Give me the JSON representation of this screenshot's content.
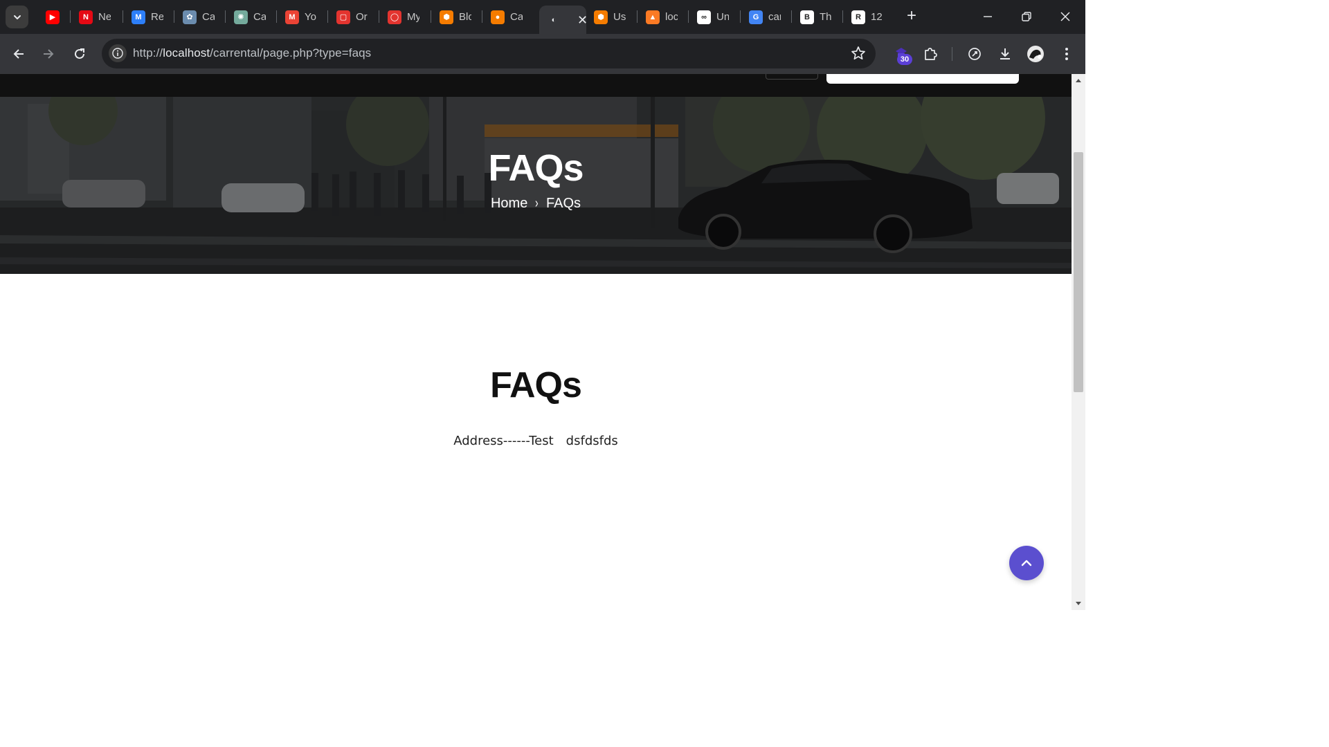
{
  "browser": {
    "tabs": [
      {
        "title": "",
        "icon": "youtube-icon",
        "color": "#ff0000"
      },
      {
        "title": "Ne",
        "icon": "netflix-icon",
        "color": "#e50914"
      },
      {
        "title": "Re",
        "icon": "metaview-icon",
        "color": "#2d7ff9"
      },
      {
        "title": "Ca",
        "icon": "car-site-icon",
        "color": "#6b8cae"
      },
      {
        "title": "Ca",
        "icon": "chatgpt-icon",
        "color": "#74aa9c"
      },
      {
        "title": "Yo",
        "icon": "gmail-icon",
        "color": "#ea4335"
      },
      {
        "title": "Or",
        "icon": "oracle-icon",
        "color": "#e3342f"
      },
      {
        "title": "My",
        "icon": "oracle-ring-icon",
        "color": "#e3342f"
      },
      {
        "title": "Blc",
        "icon": "blogger-icon",
        "color": "#f57c00"
      },
      {
        "title": "Ca",
        "icon": "ubuntu-icon",
        "color": "#f57c00"
      },
      {
        "title": "",
        "icon": "page-favicon-icon",
        "color": "#e8eaed",
        "active": true
      },
      {
        "title": "Us",
        "icon": "blogger-icon",
        "color": "#f57c00"
      },
      {
        "title": "loc",
        "icon": "xampp-icon",
        "color": "#fb7a24"
      },
      {
        "title": "Un",
        "icon": "coursera-icon",
        "color": "#ffffff"
      },
      {
        "title": "car",
        "icon": "google-icon",
        "color": "#4285f4"
      },
      {
        "title": "Th",
        "icon": "bie-icon",
        "color": "#ffffff"
      },
      {
        "title": "12",
        "icon": "r-square-icon",
        "color": "#ffffff"
      }
    ],
    "new_tab_label": "+",
    "url_scheme": "http://",
    "url_host": "localhost",
    "url_path": "/carrental/page.php?type=faqs",
    "extension_badge": "30",
    "colors": {
      "tabstrip": "#202124",
      "toolbar": "#35363a",
      "omnibox": "#202124",
      "accent": "#5b4fcf"
    }
  },
  "hero": {
    "title": "FAQs",
    "breadcrumb": {
      "home": "Home",
      "separator": "›",
      "current": "FAQs"
    }
  },
  "content": {
    "heading": "FAQs",
    "text_parts": [
      "Address------Test",
      "dsfdsfds"
    ]
  }
}
